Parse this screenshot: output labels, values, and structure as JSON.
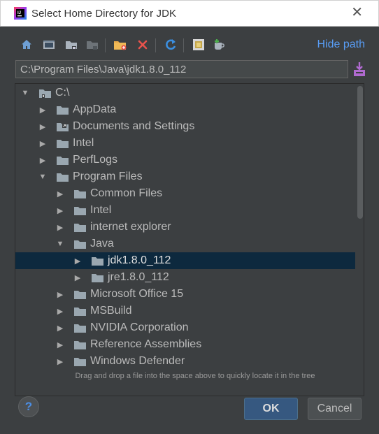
{
  "window": {
    "title": "Select Home Directory for JDK",
    "close_glyph": "✕"
  },
  "toolbar": {
    "buttons": [
      {
        "icon": "home-icon",
        "tooltip": "Home"
      },
      {
        "icon": "desktop-icon",
        "tooltip": "Desktop"
      },
      {
        "icon": "project-folder-icon",
        "tooltip": "Project"
      },
      {
        "icon": "module-folder-icon",
        "tooltip": "Module"
      },
      {
        "icon": "new-folder-icon",
        "tooltip": "New Folder"
      },
      {
        "icon": "delete-icon",
        "tooltip": "Delete"
      },
      {
        "icon": "refresh-icon",
        "tooltip": "Refresh"
      },
      {
        "icon": "show-hidden-icon",
        "tooltip": "Show Hidden"
      },
      {
        "icon": "add-sdk-icon",
        "tooltip": "Add"
      }
    ],
    "hide_path_label": "Hide path"
  },
  "path": {
    "value": "C:\\Program Files\\Java\\jdk1.8.0_112"
  },
  "tree": {
    "rows": [
      {
        "label": "C:\\",
        "depth": 0,
        "expanded": true,
        "selected": false,
        "icon": "drive-icon"
      },
      {
        "label": "AppData",
        "depth": 1,
        "expanded": false,
        "selected": false,
        "icon": "folder-icon"
      },
      {
        "label": "Documents and Settings",
        "depth": 1,
        "expanded": false,
        "selected": false,
        "icon": "folder-link-icon"
      },
      {
        "label": "Intel",
        "depth": 1,
        "expanded": false,
        "selected": false,
        "icon": "folder-icon"
      },
      {
        "label": "PerfLogs",
        "depth": 1,
        "expanded": false,
        "selected": false,
        "icon": "folder-icon"
      },
      {
        "label": "Program Files",
        "depth": 1,
        "expanded": true,
        "selected": false,
        "icon": "folder-icon"
      },
      {
        "label": "Common Files",
        "depth": 2,
        "expanded": false,
        "selected": false,
        "icon": "folder-icon"
      },
      {
        "label": "Intel",
        "depth": 2,
        "expanded": false,
        "selected": false,
        "icon": "folder-icon"
      },
      {
        "label": "internet explorer",
        "depth": 2,
        "expanded": false,
        "selected": false,
        "icon": "folder-icon"
      },
      {
        "label": "Java",
        "depth": 2,
        "expanded": true,
        "selected": false,
        "icon": "folder-icon"
      },
      {
        "label": "jdk1.8.0_112",
        "depth": 3,
        "expanded": false,
        "selected": true,
        "icon": "folder-icon"
      },
      {
        "label": "jre1.8.0_112",
        "depth": 3,
        "expanded": false,
        "selected": false,
        "icon": "folder-icon"
      },
      {
        "label": "Microsoft Office 15",
        "depth": 2,
        "expanded": false,
        "selected": false,
        "icon": "folder-icon"
      },
      {
        "label": "MSBuild",
        "depth": 2,
        "expanded": false,
        "selected": false,
        "icon": "folder-icon"
      },
      {
        "label": "NVIDIA Corporation",
        "depth": 2,
        "expanded": false,
        "selected": false,
        "icon": "folder-icon"
      },
      {
        "label": "Reference Assemblies",
        "depth": 2,
        "expanded": false,
        "selected": false,
        "icon": "folder-icon"
      },
      {
        "label": "Windows Defender",
        "depth": 2,
        "expanded": false,
        "selected": false,
        "icon": "folder-icon"
      }
    ]
  },
  "hint": "Drag and drop a file into the space above to quickly locate it in the tree",
  "footer": {
    "help_label": "?",
    "ok_label": "OK",
    "cancel_label": "Cancel"
  },
  "colors": {
    "background": "#3c3f41",
    "selection": "#0d293e",
    "link": "#589df6",
    "ok_button": "#365880"
  }
}
